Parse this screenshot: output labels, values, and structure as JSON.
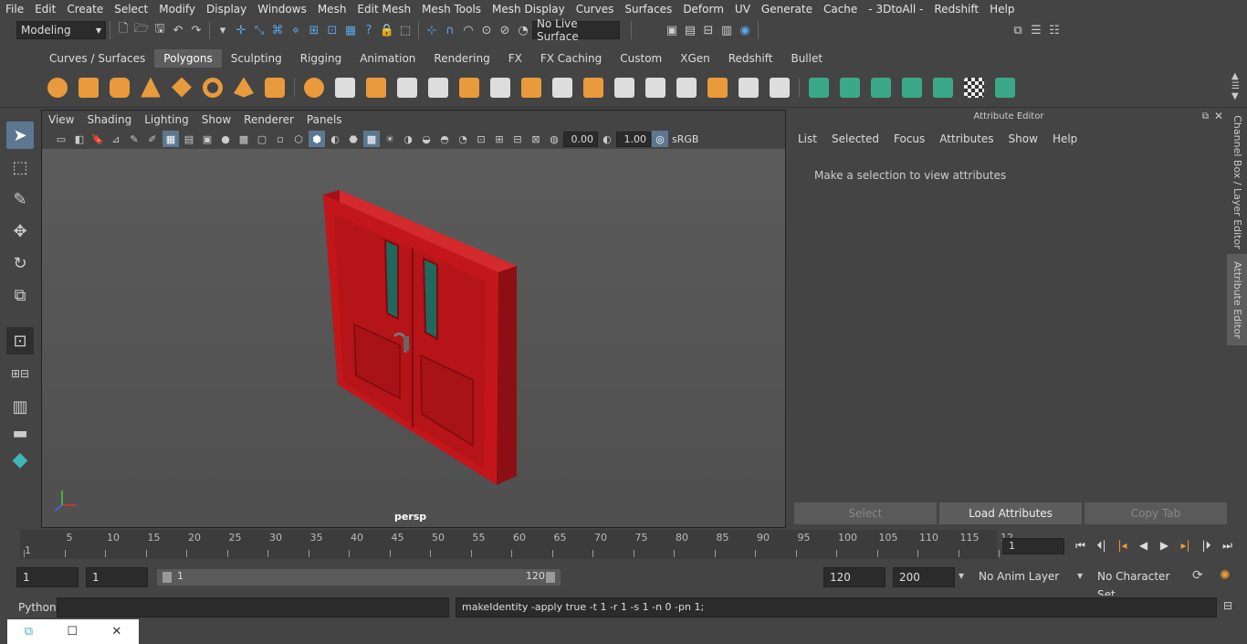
{
  "menubar": [
    "File",
    "Edit",
    "Create",
    "Select",
    "Modify",
    "Display",
    "Windows",
    "Mesh",
    "Edit Mesh",
    "Mesh Tools",
    "Mesh Display",
    "Curves",
    "Surfaces",
    "Deform",
    "UV",
    "Generate",
    "Cache",
    "- 3DtoAll -",
    "Redshift",
    "Help"
  ],
  "status": {
    "mode": "Modeling",
    "live_surface": "No Live Surface"
  },
  "shelf_tabs": [
    "Curves / Surfaces",
    "Polygons",
    "Sculpting",
    "Rigging",
    "Animation",
    "Rendering",
    "FX",
    "FX Caching",
    "Custom",
    "XGen",
    "Redshift",
    "Bullet"
  ],
  "shelf_active": "Polygons",
  "viewport": {
    "menu": [
      "View",
      "Shading",
      "Lighting",
      "Show",
      "Renderer",
      "Panels"
    ],
    "exposure": "0.00",
    "gamma": "1.00",
    "colorspace": "sRGB",
    "camera": "persp"
  },
  "attribute_editor": {
    "title": "Attribute Editor",
    "menu": [
      "List",
      "Selected",
      "Focus",
      "Attributes",
      "Show",
      "Help"
    ],
    "message": "Make a selection to view attributes",
    "buttons": [
      "Select",
      "Load Attributes",
      "Copy Tab"
    ]
  },
  "side_tabs": [
    "Channel Box / Layer Editor",
    "Attribute Editor"
  ],
  "timeline": {
    "ticks": [
      "1",
      "5",
      "10",
      "15",
      "20",
      "25",
      "30",
      "35",
      "40",
      "45",
      "50",
      "55",
      "60",
      "65",
      "70",
      "75",
      "80",
      "85",
      "90",
      "95",
      "100",
      "105",
      "110",
      "115",
      "12"
    ],
    "current_frame": "1"
  },
  "range": {
    "start": "1",
    "inner_start": "1",
    "slider_start": "1",
    "slider_end": "120",
    "end": "120",
    "total_end": "200",
    "anim_layer": "No Anim Layer",
    "character_set": "No Character Set"
  },
  "command": {
    "lang": "Python",
    "output": "makeIdentity -apply true -t 1 -r 1 -s 1 -n 0 -pn 1;"
  },
  "colors": {
    "accent": "#5d7791",
    "door": "#c3161b",
    "glass": "#1e6a5f"
  }
}
